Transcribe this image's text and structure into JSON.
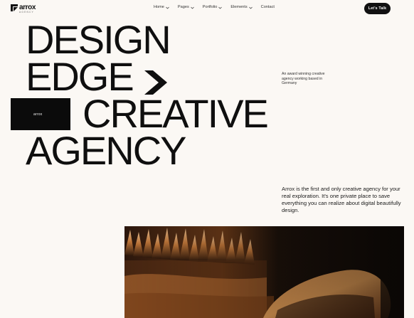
{
  "header": {
    "logo_text": "arrox",
    "logo_sub": "AGENCY",
    "nav": [
      {
        "label": "Home",
        "has_caret": true
      },
      {
        "label": "Pages",
        "has_caret": true
      },
      {
        "label": "Portfolio",
        "has_caret": true
      },
      {
        "label": "Elements",
        "has_caret": true
      },
      {
        "label": "Contact",
        "has_caret": false
      }
    ],
    "cta_label": "Let's Talk"
  },
  "hero": {
    "line1": "DESIGN",
    "line2": "EDGE",
    "line3": "CREATIVE",
    "line4": "AGENCY",
    "badge_label": "arrox"
  },
  "side_blurb": "An award winning creative agency working based in Germany",
  "intro": "Arrox is the first and only creative agency for your real exploration. It's one private place to save everything you can realize about digital beautifully design.",
  "colors": {
    "background": "#fbf8f4",
    "text": "#111111",
    "accent_dark": "#0b0b0b",
    "image_tone": "#c47a3a"
  },
  "icons": {
    "logo": "arrox-logo-mark",
    "arrow": "arrow-chevron-right-icon",
    "caret": "chevron-down-icon"
  }
}
